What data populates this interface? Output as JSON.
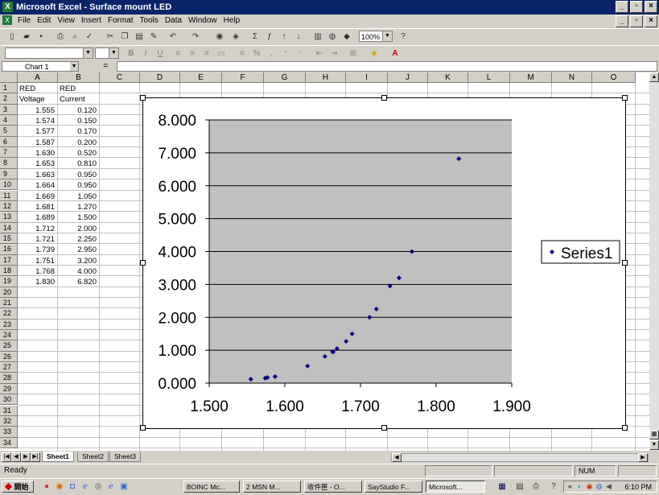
{
  "window": {
    "title": "Microsoft Excel - Surface mount LED"
  },
  "menu": {
    "items": [
      "File",
      "Edit",
      "View",
      "Insert",
      "Format",
      "Tools",
      "Data",
      "Window",
      "Help"
    ]
  },
  "toolbar": {
    "zoom": "100%",
    "font_size": "",
    "icons": {
      "new": "new-doc-icon",
      "open": "open-folder-icon",
      "save": "save-icon",
      "print": "print-icon",
      "preview": "print-preview-icon",
      "spell": "spellcheck-icon",
      "cut": "cut-icon",
      "copy": "copy-icon",
      "paste": "paste-icon",
      "undo": "undo-icon",
      "redo": "redo-icon",
      "sum": "autosum-icon",
      "chart": "chart-wizard-icon"
    }
  },
  "format_toolbar": {
    "labels": [
      "B",
      "I",
      "U",
      "%",
      ","
    ]
  },
  "formula_bar": {
    "name_box": "Chart 1",
    "eq": "="
  },
  "columns": [
    "A",
    "B",
    "C",
    "D",
    "E",
    "F",
    "G",
    "H",
    "I",
    "J",
    "K",
    "L",
    "M",
    "N",
    "O"
  ],
  "rows": [
    "1",
    "2",
    "3",
    "4",
    "5",
    "6",
    "7",
    "8",
    "9",
    "10",
    "11",
    "12",
    "13",
    "14",
    "15",
    "16",
    "17",
    "18",
    "19",
    "20",
    "21",
    "22",
    "23",
    "24",
    "25",
    "26",
    "27",
    "28",
    "29",
    "30",
    "31",
    "32",
    "33",
    "34"
  ],
  "sheet": {
    "header_row1": [
      "RED",
      "RED"
    ],
    "header_row2": [
      "Voltage",
      "Current"
    ],
    "data": [
      [
        "1.555",
        "0.120"
      ],
      [
        "1.574",
        "0.150"
      ],
      [
        "1.577",
        "0.170"
      ],
      [
        "1.587",
        "0.200"
      ],
      [
        "1.630",
        "0.520"
      ],
      [
        "1.653",
        "0.810"
      ],
      [
        "1.663",
        "0.950"
      ],
      [
        "1.664",
        "0.950"
      ],
      [
        "1.669",
        "1.050"
      ],
      [
        "1.681",
        "1.270"
      ],
      [
        "1.689",
        "1.500"
      ],
      [
        "1.712",
        "2.000"
      ],
      [
        "1.721",
        "2.250"
      ],
      [
        "1.739",
        "2.950"
      ],
      [
        "1.751",
        "3.200"
      ],
      [
        "1.768",
        "4.000"
      ],
      [
        "1.830",
        "6.820"
      ]
    ]
  },
  "chart_data": {
    "type": "scatter",
    "series": [
      {
        "name": "Series1",
        "x": [
          1.555,
          1.574,
          1.577,
          1.587,
          1.63,
          1.653,
          1.663,
          1.664,
          1.669,
          1.681,
          1.689,
          1.712,
          1.721,
          1.739,
          1.751,
          1.768,
          1.83
        ],
        "y": [
          0.12,
          0.15,
          0.17,
          0.2,
          0.52,
          0.81,
          0.95,
          0.95,
          1.05,
          1.27,
          1.5,
          2.0,
          2.25,
          2.95,
          3.2,
          4.0,
          6.82
        ]
      }
    ],
    "xlim": [
      1.5,
      1.9
    ],
    "ylim": [
      0,
      8
    ],
    "xticks": [
      "1.500",
      "1.600",
      "1.700",
      "1.800",
      "1.900"
    ],
    "yticks": [
      "0.000",
      "1.000",
      "2.000",
      "3.000",
      "4.000",
      "5.000",
      "6.000",
      "7.000",
      "8.000"
    ],
    "legend": "right",
    "grid": "horizontal",
    "plot_bg": "#c0c0c0",
    "marker_color": "#000080",
    "title": "",
    "xlabel": "",
    "ylabel": ""
  },
  "tabs": [
    "Sheet1",
    "Sheet2",
    "Sheet3"
  ],
  "status": {
    "ready": "Ready",
    "num": "NUM"
  },
  "taskbar": {
    "start": "開始",
    "tasks": [
      "BOINC Mc...",
      "2 MSN M...",
      "收件匣 - O...",
      "SayStudio F...",
      "Microsoft..."
    ],
    "clock": "6:10 PM"
  }
}
